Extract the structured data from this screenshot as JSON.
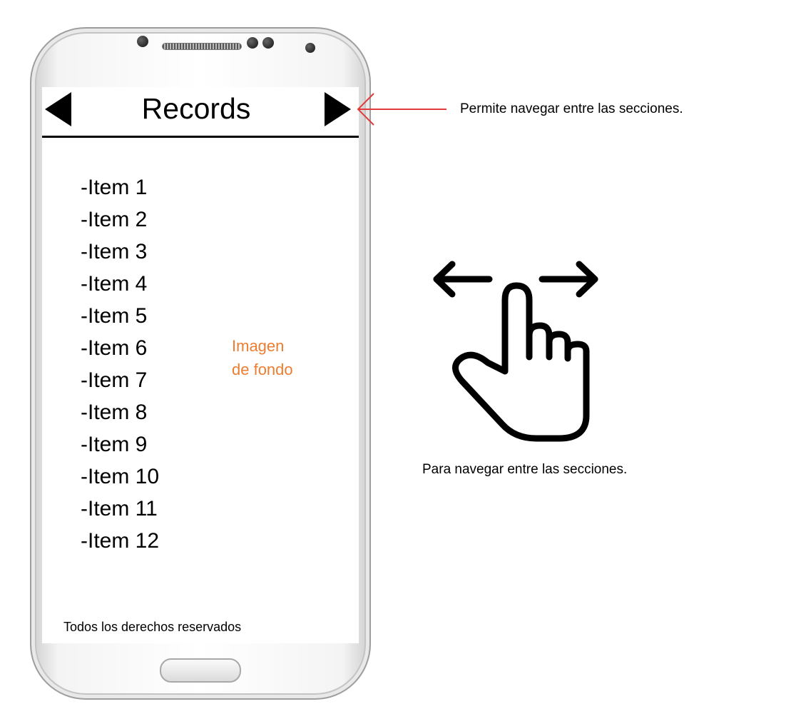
{
  "screen": {
    "title": "Records",
    "nav_prev_icon": "triangle-left-icon",
    "nav_next_icon": "triangle-right-icon",
    "items": [
      {
        "label": "-Item 1"
      },
      {
        "label": "-Item 2"
      },
      {
        "label": "-Item 3"
      },
      {
        "label": "-Item 4"
      },
      {
        "label": "-Item 5"
      },
      {
        "label": "-Item 6"
      },
      {
        "label": "-Item 7"
      },
      {
        "label": "-Item 8"
      },
      {
        "label": "-Item 9"
      },
      {
        "label": "-Item 10"
      },
      {
        "label": "-Item 11"
      },
      {
        "label": "-Item 12"
      }
    ],
    "background_note_line1": "Imagen",
    "background_note_line2": "de fondo",
    "footer": "Todos los derechos reservados"
  },
  "annotations": {
    "nav_arrow_text": "Permite navegar entre las secciones.",
    "swipe_text": "Para navegar entre las secciones.",
    "swipe_icon": "swipe-gesture-hand-icon",
    "pointer_icon": "red-arrow-icon"
  },
  "colors": {
    "accent_orange": "#ed7d31",
    "annotation_red": "#e03a3a"
  }
}
